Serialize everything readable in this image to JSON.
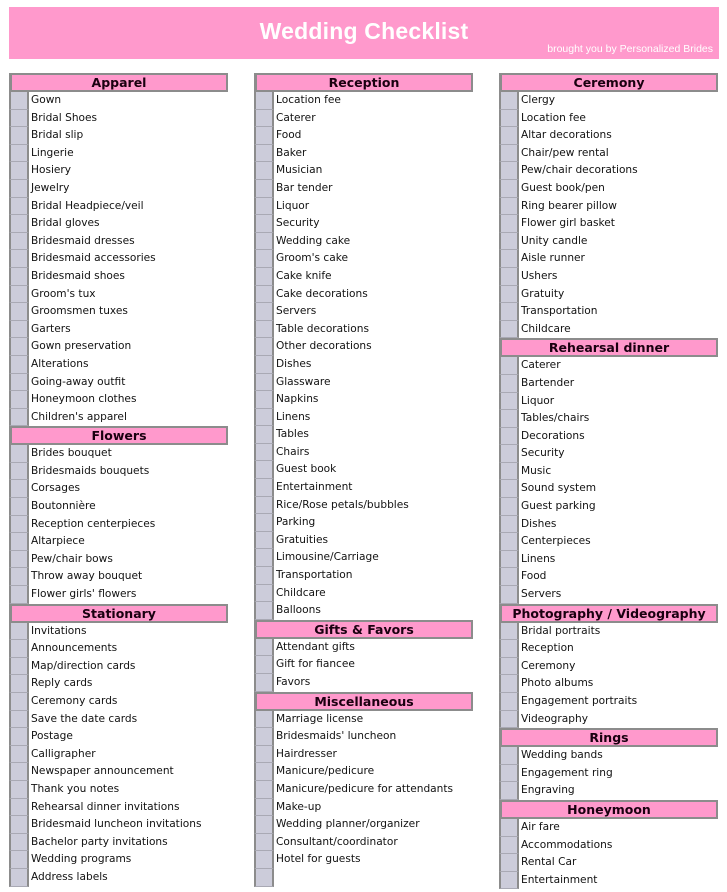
{
  "banner": {
    "title": "Wedding Checklist",
    "subtitle": "brought you by Personalized Brides",
    "color": "#ff99cc"
  },
  "columns": [
    {
      "sections": [
        {
          "title": "Apparel",
          "items": [
            "Gown",
            "Bridal Shoes",
            "Bridal slip",
            "Lingerie",
            "Hosiery",
            "Jewelry",
            "Bridal Headpiece/veil",
            "Bridal gloves",
            "Bridesmaid dresses",
            "Bridesmaid accessories",
            "Bridesmaid shoes",
            "Groom's tux",
            "Groomsmen tuxes",
            "Garters",
            "Gown preservation",
            "Alterations",
            "Going-away outfit",
            "Honeymoon clothes",
            "Children's apparel"
          ]
        },
        {
          "title": "Flowers",
          "items": [
            "Brides bouquet",
            "Bridesmaids bouquets",
            "Corsages",
            "Boutonnière",
            "Reception centerpieces",
            "Altarpiece",
            "Pew/chair bows",
            "Throw away bouquet",
            "Flower girls' flowers"
          ]
        },
        {
          "title": "Stationary",
          "items": [
            "Invitations",
            "Announcements",
            "Map/direction cards",
            "Reply cards",
            "Ceremony cards",
            "Save the date cards",
            "Postage",
            "Calligrapher",
            "Newspaper announcement",
            "Thank you notes",
            "Rehearsal dinner invitations",
            "Bridesmaid luncheon invitations",
            "Bachelor party invitations",
            "Wedding programs",
            "Address labels"
          ]
        }
      ]
    },
    {
      "sections": [
        {
          "title": "Reception",
          "items": [
            "Location fee",
            "Caterer",
            "Food",
            "Baker",
            "Musician",
            "Bar tender",
            "Liquor",
            "Security",
            "Wedding cake",
            "Groom's cake",
            "Cake knife",
            "Cake decorations",
            "Servers",
            "Table decorations",
            "Other decorations",
            "Dishes",
            "Glassware",
            "Napkins",
            "Linens",
            "Tables",
            "Chairs",
            "Guest book",
            "Entertainment",
            "Rice/Rose petals/bubbles",
            "Parking",
            "Gratuities",
            "Limousine/Carriage",
            "Transportation",
            "Childcare",
            "Balloons"
          ]
        },
        {
          "title": "Gifts & Favors",
          "items": [
            "Attendant gifts",
            "Gift for fiancee",
            "Favors"
          ]
        },
        {
          "title": "Miscellaneous",
          "items": [
            "Marriage license",
            "Bridesmaids' luncheon",
            "Hairdresser",
            "Manicure/pedicure",
            "Manicure/pedicure for attendants",
            "Make-up",
            "Wedding planner/organizer",
            "Consultant/coordinator",
            "Hotel for guests",
            ""
          ]
        }
      ]
    },
    {
      "sections": [
        {
          "title": "Ceremony",
          "items": [
            "Clergy",
            "Location fee",
            "Altar decorations",
            "Chair/pew rental",
            "Pew/chair decorations",
            "Guest book/pen",
            "Ring bearer pillow",
            "Flower girl basket",
            "Unity candle",
            "Aisle runner",
            "Ushers",
            "Gratuity",
            "Transportation",
            "Childcare"
          ]
        },
        {
          "title": "Rehearsal dinner",
          "items": [
            "Caterer",
            "Bartender",
            "Liquor",
            "Tables/chairs",
            "Decorations",
            "Security",
            "Music",
            "Sound system",
            "Guest parking",
            "Dishes",
            "Centerpieces",
            "Linens",
            "Food",
            "Servers"
          ]
        },
        {
          "title": "Photography / Videography",
          "items": [
            "Bridal portraits",
            "Reception",
            "Ceremony",
            "Photo albums",
            "Engagement portraits",
            "Videography"
          ]
        },
        {
          "title": "Rings",
          "items": [
            "Wedding bands",
            "Engagement ring",
            "Engraving"
          ]
        },
        {
          "title": "Honeymoon",
          "items": [
            "Air fare",
            "Accommodations",
            "Rental Car",
            "Entertainment"
          ]
        }
      ]
    }
  ]
}
